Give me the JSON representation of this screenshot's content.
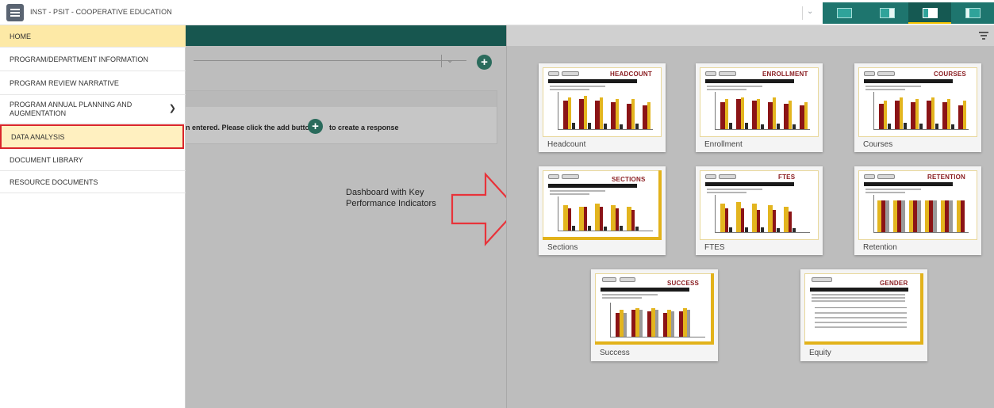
{
  "header": {
    "app_title": "INST - PSIT - COOPERATIVE EDUCATION",
    "menu_icon": "hamburger-icon",
    "layout_options": [
      "layout-left-icon",
      "layout-right-icon",
      "layout-split-icon",
      "layout-full-icon"
    ],
    "active_layout_index": 2
  },
  "sidebar": {
    "items": [
      {
        "label": "HOME",
        "state": "active"
      },
      {
        "label": "PROGRAM/DEPARTMENT INFORMATION"
      },
      {
        "label": "PROGRAM REVIEW NARRATIVE"
      },
      {
        "label": "PROGRAM ANNUAL PLANNING AND AUGMENTATION",
        "has_chevron": true,
        "chevron_icon": "chevron-down-icon"
      },
      {
        "label": "DATA ANALYSIS",
        "state": "highlighted"
      },
      {
        "label": "DOCUMENT LIBRARY"
      },
      {
        "label": "RESOURCE DOCUMENTS"
      }
    ]
  },
  "middle": {
    "no_response_text": "n entered. Please click the add button",
    "no_response_text2": "to create a response",
    "add_icon": "plus-circle-icon"
  },
  "annotation": {
    "text": "Dashboard with Key Performance Indicators",
    "arrow_icon": "right-arrow-outline-icon",
    "arrow_color": "#e8333a"
  },
  "dashboard": {
    "filter_icon": "filter-icon",
    "cards": [
      {
        "label": "Headcount",
        "thumb_title": "HEADCOUNT"
      },
      {
        "label": "Enrollment",
        "thumb_title": "ENROLLMENT"
      },
      {
        "label": "Courses",
        "thumb_title": "COURSES"
      },
      {
        "label": "Sections",
        "thumb_title": "SECTIONS"
      },
      {
        "label": "FTES",
        "thumb_title": "FTES"
      },
      {
        "label": "Retention",
        "thumb_title": "RETENTION"
      },
      {
        "label": "Success",
        "thumb_title": "SUCCESS"
      },
      {
        "label": "Equity",
        "thumb_title": "GENDER"
      }
    ]
  },
  "colors": {
    "teal": "#1e756e",
    "dark_teal": "#17564f",
    "home_highlight": "#fde9a6",
    "selection_border": "#d9252b",
    "bar_red": "#8b1416",
    "bar_gold": "#e3b51f",
    "bar_dark": "#2a2a2a",
    "bar_gray": "#9a9a9a"
  }
}
